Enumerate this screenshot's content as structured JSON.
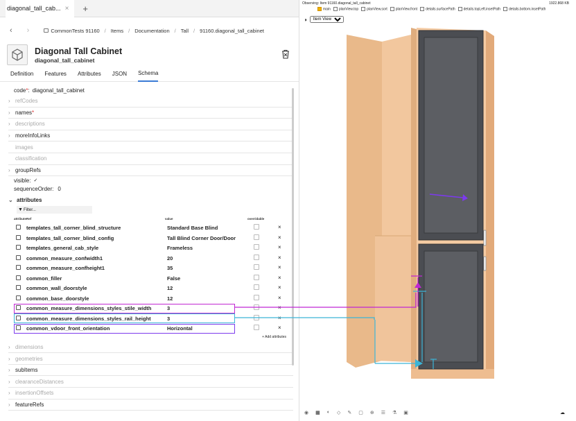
{
  "tab": {
    "title": "diagonal_tall_cab...",
    "close": "×",
    "plus": "+"
  },
  "breadcrumb": {
    "items": [
      "CommonTests 91160",
      "Items",
      "Documentation",
      "Tall",
      "91160.diagonal_tall_cabinet"
    ]
  },
  "header": {
    "title": "Diagonal Tall Cabinet",
    "subtitle": "diagonal_tall_cabinet"
  },
  "subtabs": [
    "Definition",
    "Features",
    "Attributes",
    "JSON",
    "Schema"
  ],
  "code": {
    "label": "code",
    "req": "*",
    "value": "diagonal_tall_cabinet"
  },
  "sections_top": [
    {
      "label": "refCodes",
      "dim": true,
      "chev": true
    },
    {
      "label": "names",
      "dim": false,
      "chev": true,
      "req": true
    },
    {
      "label": "descriptions",
      "dim": true,
      "chev": true
    },
    {
      "label": "moreInfoLinks",
      "dim": false,
      "chev": true
    },
    {
      "label": "images",
      "dim": true,
      "chev": false
    },
    {
      "label": "classification",
      "dim": true,
      "chev": false
    },
    {
      "label": "groupRefs",
      "dim": false,
      "chev": true
    }
  ],
  "visible": {
    "label": "visible:",
    "check": "✓"
  },
  "sequence": {
    "label": "sequenceOrder:",
    "value": "0"
  },
  "attributes": {
    "label": "attributes",
    "filter": "Filter...",
    "col1": "attributeRef",
    "col2": "value",
    "col3": "overridable",
    "rows": [
      {
        "name": "templates_tall_corner_blind_structure",
        "value": "Standard Base Blind"
      },
      {
        "name": "templates_tall_corner_blind_config",
        "value": "Tall Blind Corner Door/Door"
      },
      {
        "name": "templates_general_cab_style",
        "value": "Frameless"
      },
      {
        "name": "common_measure_confwidth1",
        "value": "20"
      },
      {
        "name": "common_measure_confheight1",
        "value": "35"
      },
      {
        "name": "common_filler",
        "value": "False"
      },
      {
        "name": "common_wall_doorstyle",
        "value": "12"
      },
      {
        "name": "common_base_doorstyle",
        "value": "12"
      },
      {
        "name": "common_measure_dimensions_styles_stile_width",
        "value": "3"
      },
      {
        "name": "common_measure_dimensions_styles_rail_height",
        "value": "3"
      },
      {
        "name": "common_vdoor_front_orientation",
        "value": "Horizontal"
      }
    ],
    "add": "+ Add attributes",
    "x": "×"
  },
  "sections_bottom": [
    {
      "label": "dimensions",
      "dim": true
    },
    {
      "label": "geometries",
      "dim": true
    },
    {
      "label": "subItems",
      "dim": false
    },
    {
      "label": "clearanceDistances",
      "dim": true
    },
    {
      "label": "insertionOffsets",
      "dim": true
    },
    {
      "label": "featureRefs",
      "dim": false
    }
  ],
  "viewer": {
    "observing": "Observing: Item 91160.diagonal_tall_cabinet",
    "size": "1922.868 KB",
    "views": [
      "main",
      "planView.top",
      "planView.sort",
      "planView.front",
      "details.surfacePath",
      "details.topLeft.insetPath",
      "details.bottom.insetPath"
    ],
    "select": "Item View"
  },
  "colors": {
    "stile": "#c026d3",
    "rail": "#3bb5d8",
    "orient": "#7c3aed"
  }
}
